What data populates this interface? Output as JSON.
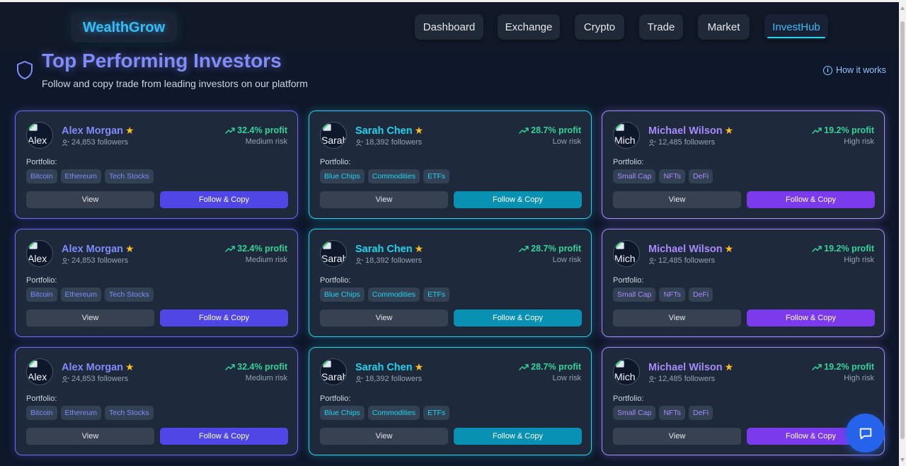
{
  "brand": {
    "name": "WealthGrow"
  },
  "nav": {
    "items": [
      {
        "label": "Dashboard",
        "active": false
      },
      {
        "label": "Exchange",
        "active": false
      },
      {
        "label": "Crypto",
        "active": false
      },
      {
        "label": "Trade",
        "active": false
      },
      {
        "label": "Market",
        "active": false
      },
      {
        "label": "InvestHub",
        "active": true
      }
    ]
  },
  "page": {
    "title": "Top Performing Investors",
    "subtitle": "Follow and copy trade from leading investors on our platform",
    "how_link": "How it works",
    "title_icon": "shield-icon"
  },
  "portfolio_label": "Portfolio:",
  "view_label": "View",
  "follow_label": "Follow & Copy",
  "investors": [
    {
      "name": "Alex Morgan",
      "avatar_alt": "Alex",
      "followers": "24,853 followers",
      "profit": "32.4% profit",
      "risk": "Medium risk",
      "tags": [
        "Bitcoin",
        "Ethereum",
        "Tech Stocks"
      ],
      "accent": "#6366f1"
    },
    {
      "name": "Sarah Chen",
      "avatar_alt": "Sarah",
      "followers": "18,392 followers",
      "profit": "28.7% profit",
      "risk": "Low risk",
      "tags": [
        "Blue Chips",
        "Commodities",
        "ETFs"
      ],
      "accent": "#22d3ee"
    },
    {
      "name": "Michael Wilson",
      "avatar_alt": "Mich",
      "followers": "12,485 followers",
      "profit": "19.2% profit",
      "risk": "High risk",
      "tags": [
        "Small Cap",
        "NFTs",
        "DeFi"
      ],
      "accent": "#a78bfa"
    }
  ],
  "colors": {
    "background": "#0f172a",
    "card": "#1e293b",
    "profit": "#34d399",
    "star": "#fbbf24",
    "chat": "#2563eb"
  }
}
